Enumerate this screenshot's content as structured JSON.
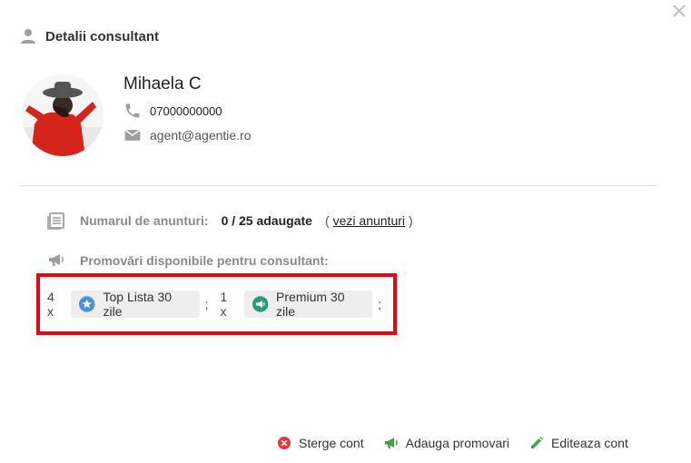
{
  "dialog": {
    "title": "Detalii consultant",
    "close_icon": "close-icon"
  },
  "consultant": {
    "name": "Mihaela C",
    "phone": "07000000000",
    "email": "agent@agentie.ro"
  },
  "listings": {
    "label": "Numarul de anunturi:",
    "value": "0 / 25 adaugate",
    "paren_open": "(",
    "link_label": "vezi anunturi",
    "paren_close": ")"
  },
  "promotions": {
    "label": "Promovări disponibile pentru consultant:",
    "items": [
      {
        "quantity": "4 x",
        "name": "Top Lista 30 zile",
        "separator": ";",
        "icon": "star-icon",
        "color": "#4a90e2"
      },
      {
        "quantity": "1 x",
        "name": "Premium 30 zile",
        "separator": ";",
        "icon": "megaphone-icon",
        "color": "#1f9d7a"
      }
    ]
  },
  "actions": {
    "delete_label": "Sterge cont",
    "add_promo_label": "Adauga promovari",
    "edit_label": "Editeaza cont"
  },
  "colors": {
    "highlight_border": "#e30613",
    "delete": "#e53935",
    "add_promo": "#43a047",
    "edit": "#43a047",
    "icon_gray": "#9e9e9e"
  }
}
